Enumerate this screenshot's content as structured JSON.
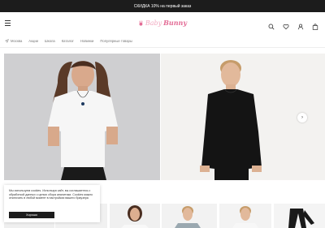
{
  "promo_bar": {
    "text": "СКИДКА 10% на первый заказ"
  },
  "header": {
    "logo_part1": "Baby",
    "logo_part2": "Bunny",
    "icons": [
      "search-icon",
      "heart-icon",
      "user-icon",
      "bag-icon"
    ]
  },
  "nav": {
    "location": "Москва",
    "items": [
      "Акции",
      "Школа",
      "Каталог",
      "Новинки",
      "Популярные товары"
    ]
  },
  "slider": {
    "next_icon": "›"
  },
  "cookie": {
    "text": "Мы используем cookies. Используя сайт, вы соглашаетесь с обработкой данных с целью сбора аналитики. Cookies можно отключить в любой момент в настройках вашего браузера",
    "button": "Хорошо"
  },
  "colors": {
    "accent": "#e36b95",
    "dark": "#1c1c1c"
  }
}
